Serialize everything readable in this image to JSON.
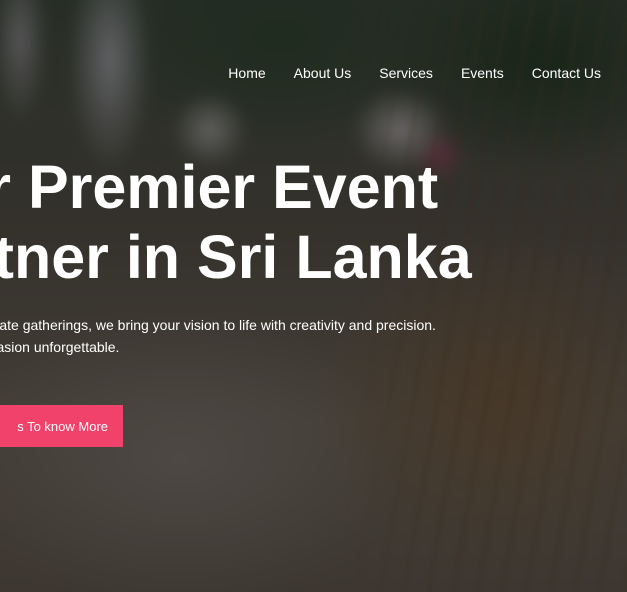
{
  "nav": {
    "items": [
      {
        "label": "Home"
      },
      {
        "label": "About Us"
      },
      {
        "label": "Services"
      },
      {
        "label": "Events"
      },
      {
        "label": "Contact Us"
      }
    ]
  },
  "hero": {
    "headline_line1": "ur Premier Event",
    "headline_line2": "artner in Sri Lanka",
    "description_line1": "o corporate gatherings, we bring your vision to life with creativity and precision.",
    "description_line2": "ecial occasion unforgettable.",
    "cta_label": "s To know More"
  },
  "colors": {
    "accent": "#f0426a",
    "overlay": "#0a0a0a",
    "text": "#ffffff"
  }
}
